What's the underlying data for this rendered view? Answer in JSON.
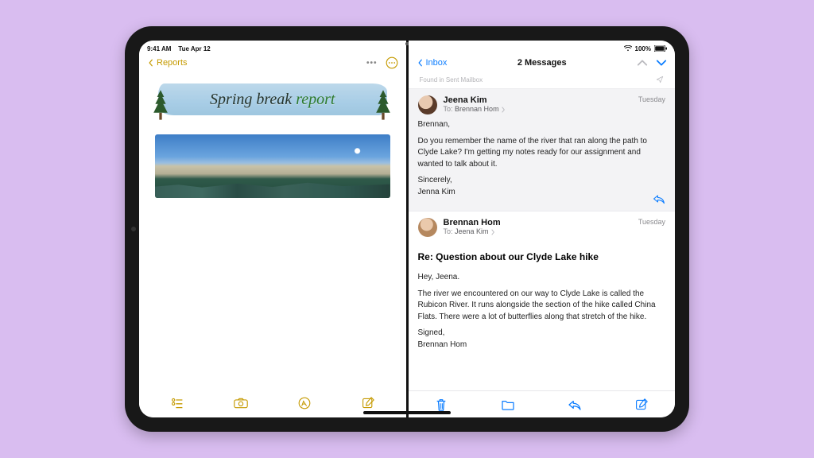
{
  "status": {
    "time": "9:41 AM",
    "date": "Tue Apr 12",
    "battery": "100%"
  },
  "notes": {
    "back_label": "Reports",
    "title_part1": "Spring break ",
    "title_part2": "report"
  },
  "mail": {
    "back_label": "Inbox",
    "title": "2 Messages",
    "found_label": "Found in Sent Mailbox",
    "messages": [
      {
        "from": "Jeena Kim",
        "to_prefix": "To:",
        "to": "Brennan Hom",
        "date": "Tuesday",
        "greeting": "Brennan,",
        "body": "Do you remember the name of the river that ran along the path to Clyde Lake? I'm getting my notes ready for our assignment and wanted to talk about it.",
        "signoff": "Sincerely,",
        "signature": "Jenna Kim"
      },
      {
        "from": "Brennan Hom",
        "to_prefix": "To:",
        "to": "Jeena Kim",
        "date": "Tuesday",
        "subject": "Re: Question about our Clyde Lake hike",
        "greeting": "Hey, Jeena.",
        "body": "The river we encountered on our way to Clyde Lake is called the Rubicon River. It runs alongside the section of the hike called China Flats. There were a lot of butterflies along that stretch of the hike.",
        "signoff": "Signed,",
        "signature": "Brennan Hom"
      }
    ]
  }
}
